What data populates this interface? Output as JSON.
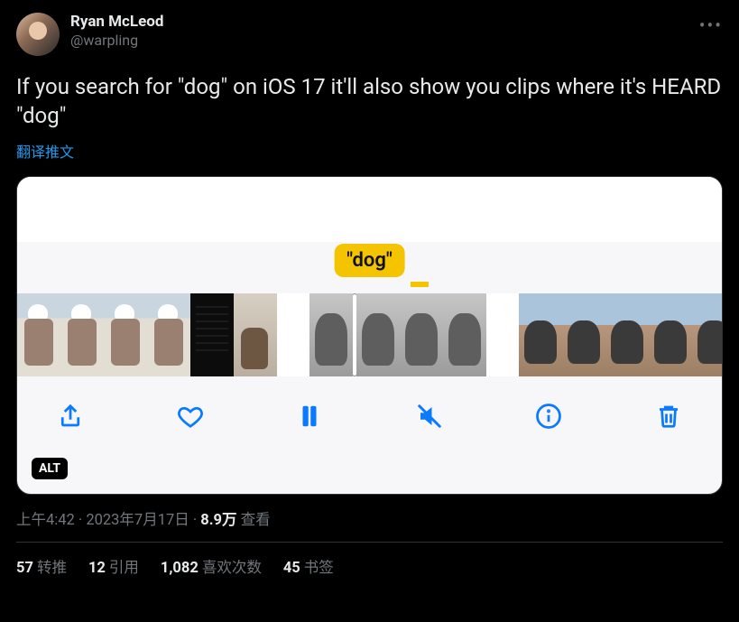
{
  "author": {
    "display_name": "Ryan McLeod",
    "handle": "@warpling"
  },
  "tweet_text": "If you search for \"dog\" on iOS 17 it'll also show you clips where it's HEARD \"dog\"",
  "translate_label": "翻译推文",
  "media": {
    "alt_badge": "ALT",
    "search_pill": "\"dog\""
  },
  "meta": {
    "time": "上午4:42",
    "date": "2023年7月17日",
    "views_number": "8.9万",
    "views_label": "查看",
    "separator": " · "
  },
  "stats": {
    "retweets": {
      "count": "57",
      "label": "转推"
    },
    "quotes": {
      "count": "12",
      "label": "引用"
    },
    "likes": {
      "count": "1,082",
      "label": "喜欢次数"
    },
    "bookmarks": {
      "count": "45",
      "label": "书签"
    }
  }
}
